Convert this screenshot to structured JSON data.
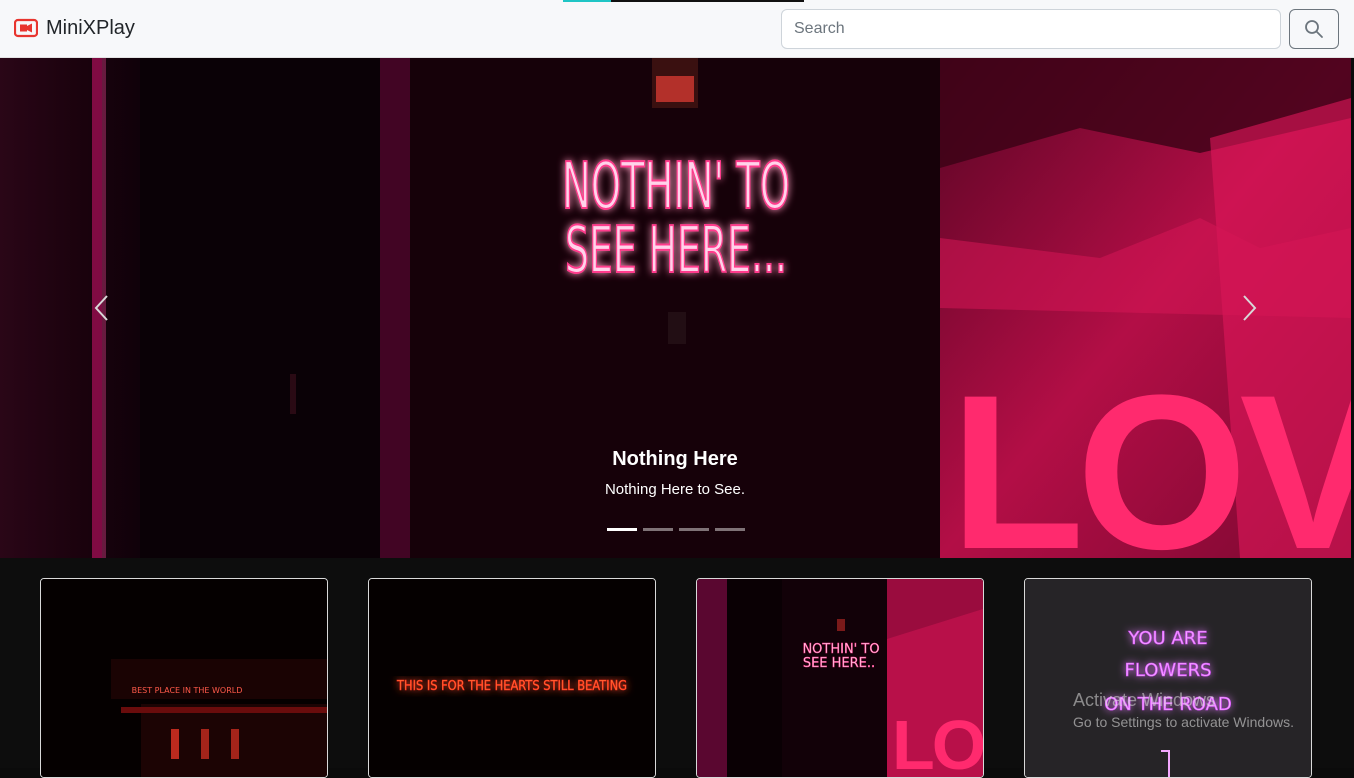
{
  "app": {
    "brand_name": "MiniXPlay",
    "brand_icon": "video-camera-icon",
    "accent": "#e8352f"
  },
  "search": {
    "placeholder": "Search",
    "value": "",
    "button_icon": "search-icon"
  },
  "hero": {
    "neon_line1": "NOTHIN' TO",
    "neon_line2": "SEE HERE...",
    "wall_text": "LOVE",
    "caption_title": "Nothing Here",
    "caption_text": "Nothing Here to See.",
    "prev_icon": "chevron-left-icon",
    "next_icon": "chevron-right-icon",
    "slides_total": 4,
    "active_slide": 1
  },
  "cards": [
    {
      "neon_text": "BEST PLACE IN THE WORLD"
    },
    {
      "neon_text": "THIS IS FOR THE HEARTS STILL BEATING"
    },
    {
      "neon_line1": "NOTHIN' TO",
      "neon_line2": "SEE HERE..",
      "wall_text": "LOVE"
    },
    {
      "neon_line1": "YOU ARE",
      "neon_line2": "FLOWERS",
      "neon_line3": "ON THE ROAD"
    }
  ],
  "watermark": {
    "title": "Activate Windows",
    "subtitle": "Go to Settings to activate Windows."
  },
  "colors": {
    "neon_pink": "#ff3a8c",
    "neon_red": "#ff3b2a",
    "neon_violet": "#e06cff",
    "wall_pink": "#e0175a"
  }
}
